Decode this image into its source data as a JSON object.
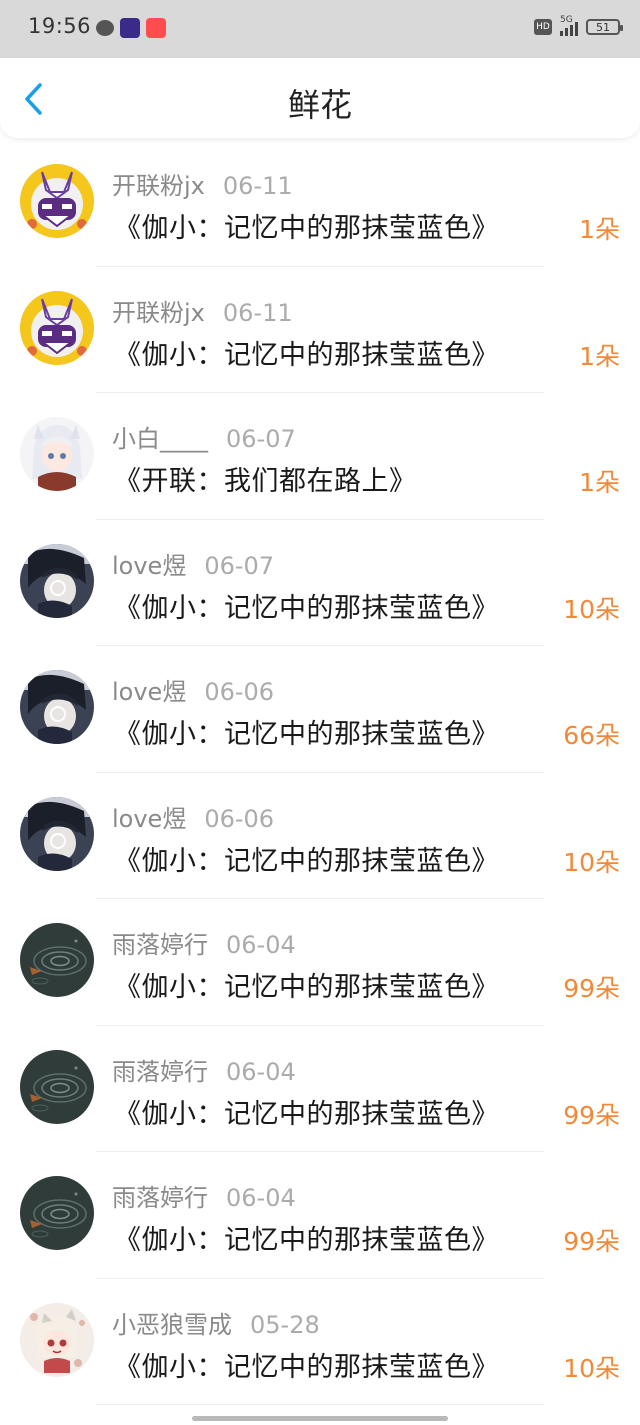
{
  "status_bar": {
    "time": "19:56",
    "hd": "HD",
    "network": "5G",
    "battery": "51"
  },
  "header": {
    "title": "鲜花"
  },
  "colors": {
    "accent": "#1a9fe6",
    "count": "#f08a3a"
  },
  "items": [
    {
      "user": "开联粉jx",
      "date": "06-11",
      "title": "《伽小：记忆中的那抹莹蓝色》",
      "count": "1朵",
      "avatar": "mecha-helmet"
    },
    {
      "user": "开联粉jx",
      "date": "06-11",
      "title": "《伽小：记忆中的那抹莹蓝色》",
      "count": "1朵",
      "avatar": "mecha-helmet"
    },
    {
      "user": "小白____",
      "date": "06-07",
      "title": "《开联：我们都在路上》",
      "count": "1朵",
      "avatar": "white-hair-girl"
    },
    {
      "user": "love煜",
      "date": "06-07",
      "title": "《伽小：记忆中的那抹莹蓝色》",
      "count": "10朵",
      "avatar": "dark-hair-boy"
    },
    {
      "user": "love煜",
      "date": "06-06",
      "title": "《伽小：记忆中的那抹莹蓝色》",
      "count": "66朵",
      "avatar": "dark-hair-boy"
    },
    {
      "user": "love煜",
      "date": "06-06",
      "title": "《伽小：记忆中的那抹莹蓝色》",
      "count": "10朵",
      "avatar": "dark-hair-boy"
    },
    {
      "user": "雨落婷行",
      "date": "06-04",
      "title": "《伽小：记忆中的那抹莹蓝色》",
      "count": "99朵",
      "avatar": "rain-ripple"
    },
    {
      "user": "雨落婷行",
      "date": "06-04",
      "title": "《伽小：记忆中的那抹莹蓝色》",
      "count": "99朵",
      "avatar": "rain-ripple"
    },
    {
      "user": "雨落婷行",
      "date": "06-04",
      "title": "《伽小：记忆中的那抹莹蓝色》",
      "count": "99朵",
      "avatar": "rain-ripple"
    },
    {
      "user": "小恶狼雪成",
      "date": "05-28",
      "title": "《伽小：记忆中的那抹莹蓝色》",
      "count": "10朵",
      "avatar": "chibi-girl"
    }
  ]
}
